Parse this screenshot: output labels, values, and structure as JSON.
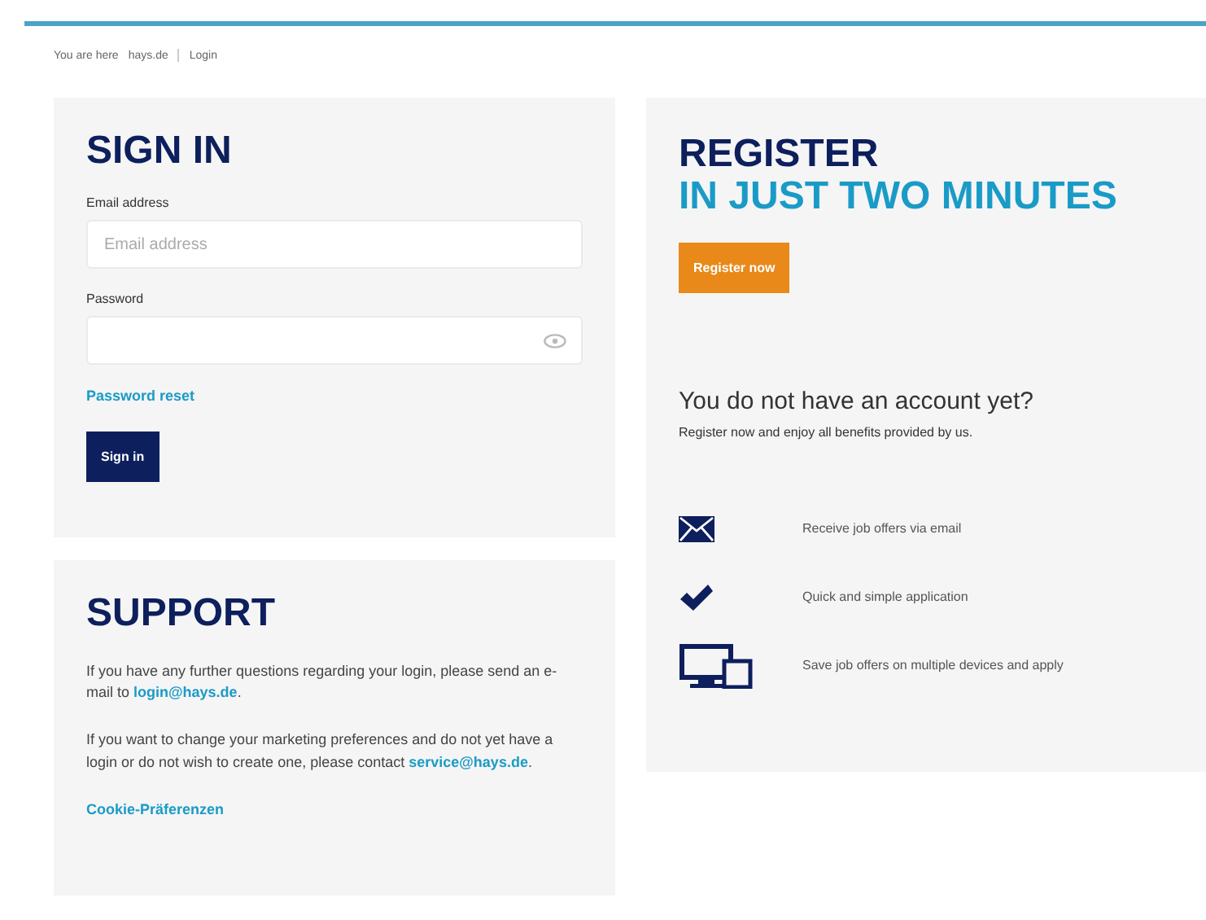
{
  "breadcrumb": {
    "label": "You are here",
    "items": [
      "hays.de",
      "Login"
    ]
  },
  "sign_in": {
    "title": "SIGN IN",
    "email_label": "Email address",
    "email_placeholder": "Email address",
    "password_label": "Password",
    "password_reset": "Password reset",
    "button": "Sign in"
  },
  "support": {
    "title": "SUPPORT",
    "paragraphs": [
      {
        "text": "If you have any further questions regarding your login, please send an e-mail to ",
        "link": "login@hays.de",
        "after": "."
      },
      {
        "text": "If you want to change your marketing preferences and do not yet have a login or do not wish to create one, please contact ",
        "link": "service@hays.de",
        "after": "."
      }
    ],
    "cookie_link": "Cookie-Präferenzen"
  },
  "register": {
    "title": "REGISTER",
    "subtitle": "IN JUST TWO MINUTES",
    "button": "Register now",
    "question": "You do not have an account yet?",
    "text": "Register now and enjoy all benefits provided by us.",
    "benefits": [
      {
        "kind": "email",
        "text": "Receive job offers via email"
      },
      {
        "kind": "check",
        "text": "Quick and simple application"
      },
      {
        "kind": "devices",
        "text": "Save job offers on multiple devices and apply"
      }
    ]
  }
}
